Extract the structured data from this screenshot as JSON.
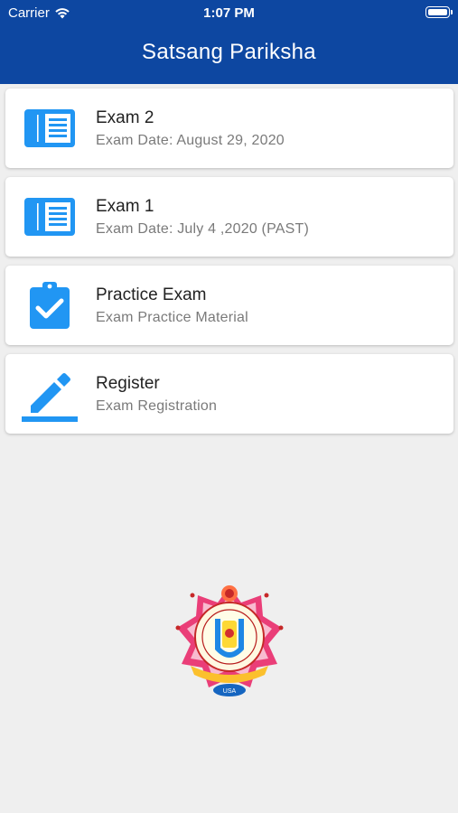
{
  "status_bar": {
    "carrier": "Carrier",
    "time": "1:07 PM",
    "wifi_icon": "wifi-icon",
    "battery_icon": "battery-icon"
  },
  "header": {
    "title": "Satsang Pariksha",
    "background": "#0d47a1"
  },
  "menu": {
    "accent": "#2196f3",
    "items": [
      {
        "title": "Exam 2",
        "subtitle": "Exam Date: August 29, 2020",
        "icon": "document-list-icon"
      },
      {
        "title": "Exam 1",
        "subtitle": "Exam Date: July 4 ,2020 (PAST)",
        "icon": "document-list-icon"
      },
      {
        "title": "Practice Exam",
        "subtitle": "Exam Practice Material",
        "icon": "clipboard-check-icon"
      },
      {
        "title": "Register",
        "subtitle": "Exam Registration",
        "icon": "pencil-edit-icon"
      }
    ]
  },
  "logo": {
    "icon": "organization-emblem",
    "text": "USA"
  }
}
